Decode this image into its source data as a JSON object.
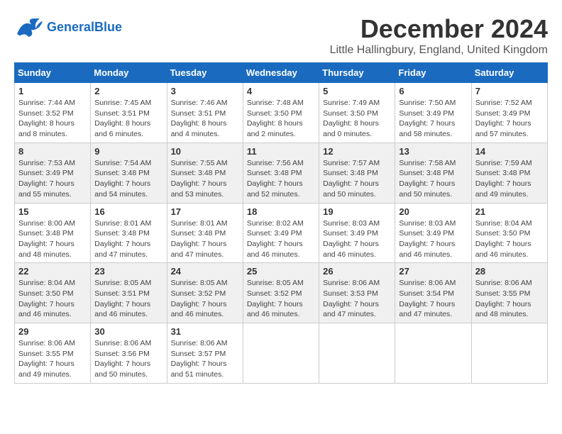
{
  "header": {
    "logo_general": "General",
    "logo_blue": "Blue",
    "month_title": "December 2024",
    "location": "Little Hallingbury, England, United Kingdom"
  },
  "days_of_week": [
    "Sunday",
    "Monday",
    "Tuesday",
    "Wednesday",
    "Thursday",
    "Friday",
    "Saturday"
  ],
  "weeks": [
    [
      {
        "day": "1",
        "sunrise": "7:44 AM",
        "sunset": "3:52 PM",
        "daylight": "8 hours and 8 minutes."
      },
      {
        "day": "2",
        "sunrise": "7:45 AM",
        "sunset": "3:51 PM",
        "daylight": "8 hours and 6 minutes."
      },
      {
        "day": "3",
        "sunrise": "7:46 AM",
        "sunset": "3:51 PM",
        "daylight": "8 hours and 4 minutes."
      },
      {
        "day": "4",
        "sunrise": "7:48 AM",
        "sunset": "3:50 PM",
        "daylight": "8 hours and 2 minutes."
      },
      {
        "day": "5",
        "sunrise": "7:49 AM",
        "sunset": "3:50 PM",
        "daylight": "8 hours and 0 minutes."
      },
      {
        "day": "6",
        "sunrise": "7:50 AM",
        "sunset": "3:49 PM",
        "daylight": "7 hours and 58 minutes."
      },
      {
        "day": "7",
        "sunrise": "7:52 AM",
        "sunset": "3:49 PM",
        "daylight": "7 hours and 57 minutes."
      }
    ],
    [
      {
        "day": "8",
        "sunrise": "7:53 AM",
        "sunset": "3:49 PM",
        "daylight": "7 hours and 55 minutes."
      },
      {
        "day": "9",
        "sunrise": "7:54 AM",
        "sunset": "3:48 PM",
        "daylight": "7 hours and 54 minutes."
      },
      {
        "day": "10",
        "sunrise": "7:55 AM",
        "sunset": "3:48 PM",
        "daylight": "7 hours and 53 minutes."
      },
      {
        "day": "11",
        "sunrise": "7:56 AM",
        "sunset": "3:48 PM",
        "daylight": "7 hours and 52 minutes."
      },
      {
        "day": "12",
        "sunrise": "7:57 AM",
        "sunset": "3:48 PM",
        "daylight": "7 hours and 50 minutes."
      },
      {
        "day": "13",
        "sunrise": "7:58 AM",
        "sunset": "3:48 PM",
        "daylight": "7 hours and 50 minutes."
      },
      {
        "day": "14",
        "sunrise": "7:59 AM",
        "sunset": "3:48 PM",
        "daylight": "7 hours and 49 minutes."
      }
    ],
    [
      {
        "day": "15",
        "sunrise": "8:00 AM",
        "sunset": "3:48 PM",
        "daylight": "7 hours and 48 minutes."
      },
      {
        "day": "16",
        "sunrise": "8:01 AM",
        "sunset": "3:48 PM",
        "daylight": "7 hours and 47 minutes."
      },
      {
        "day": "17",
        "sunrise": "8:01 AM",
        "sunset": "3:48 PM",
        "daylight": "7 hours and 47 minutes."
      },
      {
        "day": "18",
        "sunrise": "8:02 AM",
        "sunset": "3:49 PM",
        "daylight": "7 hours and 46 minutes."
      },
      {
        "day": "19",
        "sunrise": "8:03 AM",
        "sunset": "3:49 PM",
        "daylight": "7 hours and 46 minutes."
      },
      {
        "day": "20",
        "sunrise": "8:03 AM",
        "sunset": "3:49 PM",
        "daylight": "7 hours and 46 minutes."
      },
      {
        "day": "21",
        "sunrise": "8:04 AM",
        "sunset": "3:50 PM",
        "daylight": "7 hours and 46 minutes."
      }
    ],
    [
      {
        "day": "22",
        "sunrise": "8:04 AM",
        "sunset": "3:50 PM",
        "daylight": "7 hours and 46 minutes."
      },
      {
        "day": "23",
        "sunrise": "8:05 AM",
        "sunset": "3:51 PM",
        "daylight": "7 hours and 46 minutes."
      },
      {
        "day": "24",
        "sunrise": "8:05 AM",
        "sunset": "3:52 PM",
        "daylight": "7 hours and 46 minutes."
      },
      {
        "day": "25",
        "sunrise": "8:05 AM",
        "sunset": "3:52 PM",
        "daylight": "7 hours and 46 minutes."
      },
      {
        "day": "26",
        "sunrise": "8:06 AM",
        "sunset": "3:53 PM",
        "daylight": "7 hours and 47 minutes."
      },
      {
        "day": "27",
        "sunrise": "8:06 AM",
        "sunset": "3:54 PM",
        "daylight": "7 hours and 47 minutes."
      },
      {
        "day": "28",
        "sunrise": "8:06 AM",
        "sunset": "3:55 PM",
        "daylight": "7 hours and 48 minutes."
      }
    ],
    [
      {
        "day": "29",
        "sunrise": "8:06 AM",
        "sunset": "3:55 PM",
        "daylight": "7 hours and 49 minutes."
      },
      {
        "day": "30",
        "sunrise": "8:06 AM",
        "sunset": "3:56 PM",
        "daylight": "7 hours and 50 minutes."
      },
      {
        "day": "31",
        "sunrise": "8:06 AM",
        "sunset": "3:57 PM",
        "daylight": "7 hours and 51 minutes."
      },
      null,
      null,
      null,
      null
    ]
  ]
}
